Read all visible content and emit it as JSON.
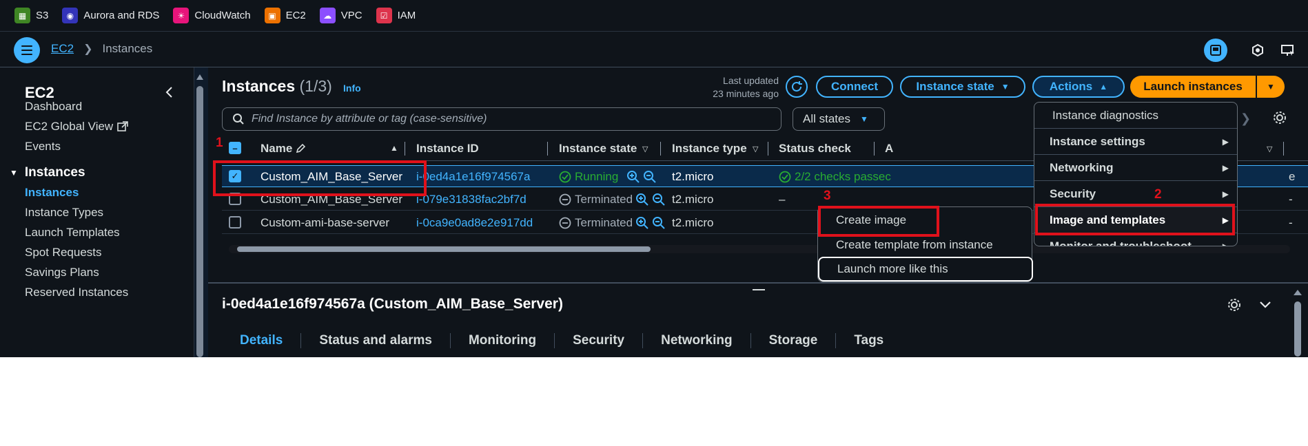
{
  "favorites": [
    {
      "label": "S3",
      "color": "#3f8624",
      "icon": "s3-icon"
    },
    {
      "label": "Aurora and RDS",
      "color": "#3334b9",
      "icon": "rds-icon"
    },
    {
      "label": "CloudWatch",
      "color": "#e7157b",
      "icon": "cloudwatch-icon"
    },
    {
      "label": "EC2",
      "color": "#ed7100",
      "icon": "ec2-icon"
    },
    {
      "label": "VPC",
      "color": "#8c4fff",
      "icon": "vpc-icon"
    },
    {
      "label": "IAM",
      "color": "#dd344c",
      "icon": "iam-icon"
    }
  ],
  "breadcrumb": {
    "service": "EC2",
    "current": "Instances"
  },
  "sidebar": {
    "title": "EC2",
    "items": [
      "Dashboard",
      "EC2 Global View",
      "Events"
    ],
    "section": "Instances",
    "section_items": [
      "Instances",
      "Instance Types",
      "Launch Templates",
      "Spot Requests",
      "Savings Plans",
      "Reserved Instances"
    ]
  },
  "header": {
    "title": "Instances",
    "count": "(1/3)",
    "info": "Info",
    "last_updated_line1": "Last updated",
    "last_updated_line2": "23 minutes ago",
    "connect": "Connect",
    "instance_state": "Instance state",
    "actions": "Actions",
    "launch": "Launch instances"
  },
  "search": {
    "placeholder": "Find Instance by attribute or tag (case-sensitive)",
    "states": "All states"
  },
  "table": {
    "columns": [
      "Name",
      "Instance ID",
      "Instance state",
      "Instance type",
      "Status check",
      "A"
    ],
    "rows": [
      {
        "name": "Custom_AIM_Base_Server",
        "id": "i-0ed4a1e16f974567a",
        "state": "Running",
        "type": "t2.micro",
        "status": "2/2 checks passec",
        "selected": true
      },
      {
        "name": "Custom_AIM_Base_Server",
        "id": "i-079e31838fac2bf7d",
        "state": "Terminated",
        "type": "t2.micro",
        "status": "–",
        "selected": false
      },
      {
        "name": "Custom-ami-base-server",
        "id": "i-0ca9e0ad8e2e917dd",
        "state": "Terminated",
        "type": "t2.micro",
        "status": "",
        "selected": false
      }
    ],
    "row1_tail": "e",
    "row2_tail": "-",
    "row3_tail": "-"
  },
  "details": {
    "title": "i-0ed4a1e16f974567a (Custom_AIM_Base_Server)",
    "tabs": [
      "Details",
      "Status and alarms",
      "Monitoring",
      "Security",
      "Networking",
      "Storage",
      "Tags"
    ]
  },
  "actions_menu": {
    "items": [
      "Instance diagnostics",
      "Instance settings",
      "Networking",
      "Security",
      "Image and templates",
      "Monitor and troubleshoot"
    ]
  },
  "submenu": {
    "items": [
      "Create image",
      "Create template from instance",
      "Launch more like this"
    ]
  },
  "annotations": [
    "1",
    "2",
    "3"
  ],
  "colors": {
    "accent": "#42b4ff",
    "primary": "#ff9900",
    "success": "#29ad32",
    "annotation": "#e0111b"
  }
}
